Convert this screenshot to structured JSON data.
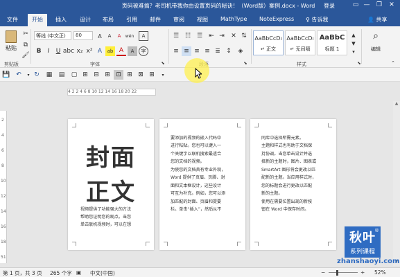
{
  "window": {
    "title": "页码被难搞？老司机带我你由设置页码的秘诀！（Word版）案例.docx - Word",
    "login": "登录",
    "minimize": "—",
    "restore": "❐",
    "close": "✕"
  },
  "tabs": [
    "文件",
    "开始",
    "插入",
    "设计",
    "布局",
    "引用",
    "邮件",
    "审阅",
    "视图",
    "MathType",
    "NoteExpress"
  ],
  "active_tab": "开始",
  "tell_me": "♀ 告诉我",
  "share": "共享",
  "ribbon": {
    "clipboard_label": "剪贴板",
    "paste_label": "粘贴",
    "font_label": "字体",
    "font_name": "等线 (中文正)",
    "font_size": "80",
    "paragraph_label": "段落",
    "styles_label": "样式",
    "editing_label": "编辑",
    "styles": [
      {
        "sample": "AaBbCcDı",
        "name": "↵ 正文"
      },
      {
        "sample": "AaBbCcDı",
        "name": "↵ 无间隔"
      },
      {
        "sample": "AaBbC",
        "name": "标题 1"
      }
    ],
    "bold": "B",
    "italic": "I",
    "underline": "U",
    "font_color_a": "A",
    "grow_font": "A",
    "shrink_font": "A",
    "clear_format": "A",
    "phonetic": "wén",
    "char_border": "A",
    "highlight": "ab",
    "font_color": "A",
    "char_shading": "A",
    "enclose": "字"
  },
  "ruler": {
    "marks": "4 2  2 4 6 8 10 12 14 16 18 20 22"
  },
  "vruler_marks": [
    "2",
    "4",
    "6",
    "8",
    "10",
    "12",
    "14",
    "16",
    "18",
    "51"
  ],
  "pages": [
    {
      "cover_title_1": "封面",
      "cover_title_2": "正文",
      "lines": [
        "视频提供了功能强大的方法",
        "帮助您证明您的观点。当您",
        "单击联机视频时，可以在想"
      ]
    },
    {
      "lines": [
        "要添加的视频的嵌入代码中",
        "进行粘贴。您也可以键入一",
        "个关键字以联机搜索最适合",
        "您的文档的视频。",
        "为使您的文档具有专业外观，",
        "Word 提供了页眉、页脚、封",
        "面和文本框设计，这些设计",
        "可互为补充。例如，您可以添",
        "加匹配的封面、页眉和提要",
        "栏。单击“插入”，然后从不"
      ]
    },
    {
      "lines": [
        "同库中选择所需元素。",
        "主题和样式也有助于文档保",
        "持协调。当您单击设计并选",
        "择新的主题时，图片、图表或",
        "SmartArt 图形将会更改以匹",
        "配新的主题。当应用样式时，",
        "您的标题会进行更改以匹配",
        "新的主题。",
        "使用在需要位置出现的新按",
        "钮在 Word 中保存时间。"
      ]
    }
  ],
  "status": {
    "page": "第 1 页，共 3 页",
    "words": "265 个字",
    "lang": "中文(中国)",
    "zoom_minus": "−",
    "zoom_plus": "+",
    "zoom": "52%"
  },
  "logo": {
    "line1": "秋叶",
    "line2": "系列课程",
    "reg": "®"
  },
  "watermark": "zhanshaoyi.com"
}
